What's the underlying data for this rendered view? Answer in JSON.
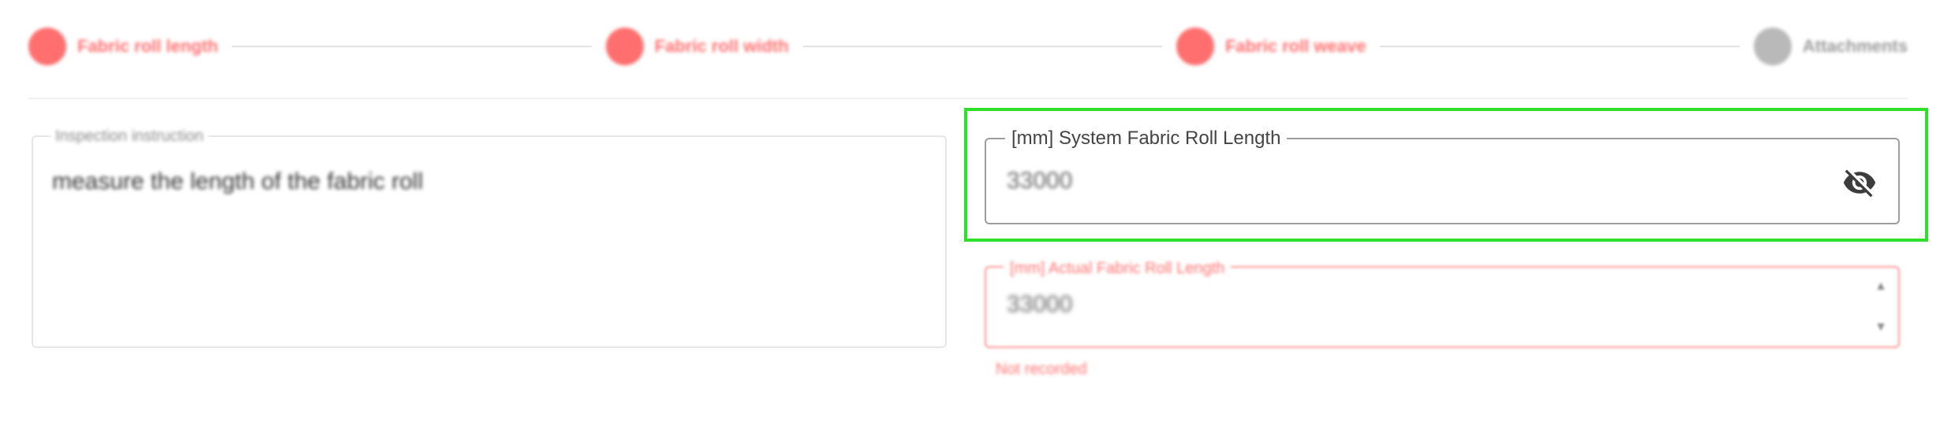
{
  "stepper": {
    "steps": [
      {
        "label": "Fabric roll length",
        "state": "error"
      },
      {
        "label": "Fabric roll width",
        "state": "error"
      },
      {
        "label": "Fabric roll weave",
        "state": "error"
      },
      {
        "label": "Attachments",
        "state": "pending"
      }
    ]
  },
  "instruction": {
    "legend": "Inspection instruction",
    "text": "measure the length of the fabric roll"
  },
  "system_field": {
    "label": "[mm] System Fabric Roll Length",
    "value": "33000",
    "icon": "visibility-off-icon"
  },
  "measured_field": {
    "label": "[mm] Actual Fabric Roll Length",
    "value": "33000",
    "error": "Not recorded"
  },
  "colors": {
    "highlight": "#2ee02a",
    "error": "#ff6f6f",
    "pending": "#b9b9b9"
  }
}
